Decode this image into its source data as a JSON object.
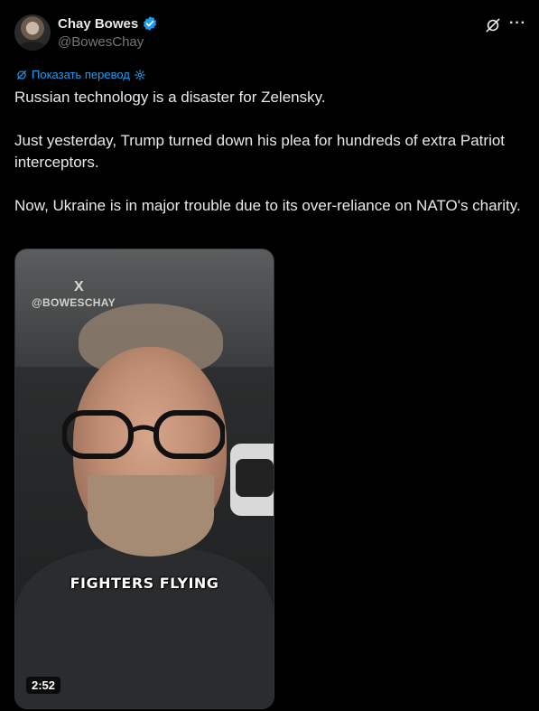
{
  "author": {
    "display_name": "Chay Bowes",
    "handle": "@BowesChay",
    "avatar_icon": "avatar",
    "verified_icon": "verified-badge-icon",
    "verified_color": "#1d9bf0"
  },
  "header_actions": {
    "grok_icon": "grok-icon",
    "more_icon": "more-icon",
    "more_glyph": "···"
  },
  "translate": {
    "label": "Показать перевод",
    "icon": "translate-icon",
    "settings_icon": "gear-icon"
  },
  "tweet": {
    "paragraphs": [
      "Russian technology is a disaster for Zelensky.",
      "Just yesterday, Trump turned down his plea for hundreds of extra Patriot interceptors.",
      "Now, Ukraine is in major trouble due to its over-reliance on NATO's charity."
    ]
  },
  "video": {
    "watermark_x": "X",
    "watermark_handle": "@BOWESCHAY",
    "caption": "FIGHTERS FLYING",
    "duration": "2:52"
  },
  "colors": {
    "background": "#000000",
    "text": "#e7e9ea",
    "secondary": "#71767b",
    "accent": "#1d9bf0"
  }
}
